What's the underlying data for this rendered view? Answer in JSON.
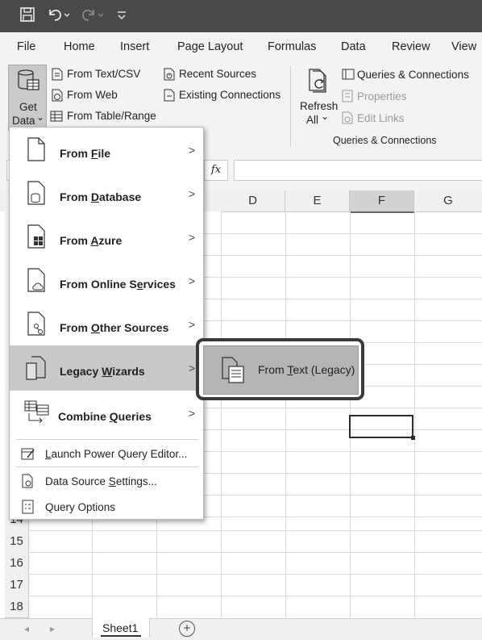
{
  "title_bar": {
    "icons": [
      "save-icon",
      "undo-icon",
      "redo-icon",
      "customize-qat-icon"
    ]
  },
  "menu_tabs": [
    {
      "label": "File"
    },
    {
      "label": "Home"
    },
    {
      "label": "Insert"
    },
    {
      "label": "Page Layout"
    },
    {
      "label": "Formulas"
    },
    {
      "label": "Data",
      "active": true
    },
    {
      "label": "Review"
    },
    {
      "label": "View"
    }
  ],
  "ribbon": {
    "get_data": {
      "line1": "Get",
      "line2": "Data",
      "chevron": "⌄"
    },
    "get_transform": [
      "From Text/CSV",
      "From Web",
      "From Table/Range"
    ],
    "recent": [
      "Recent Sources",
      "Existing Connections"
    ],
    "refresh": {
      "line1": "Refresh",
      "line2": "All",
      "chevron": "⌄"
    },
    "queries": {
      "queries_connections": "Queries & Connections",
      "properties": "Properties",
      "edit_links": "Edit Links",
      "group_label": "Queries & Connections"
    }
  },
  "formula_bar": {
    "fx": "fx"
  },
  "columns": [
    "D",
    "E",
    "F",
    "G"
  ],
  "selected_column": "F",
  "rows": [
    "14",
    "15",
    "16",
    "17",
    "18"
  ],
  "dropdown": {
    "items": [
      {
        "pre": "From ",
        "u": "F",
        "post": "ile",
        "submenu": true
      },
      {
        "pre": "From ",
        "u": "D",
        "post": "atabase",
        "submenu": true
      },
      {
        "pre": "From ",
        "u": "A",
        "post": "zure",
        "submenu": true
      },
      {
        "pre": "From Online S",
        "u": "e",
        "post": "rvices",
        "submenu": true
      },
      {
        "pre": "From ",
        "u": "O",
        "post": "ther Sources",
        "submenu": true
      },
      {
        "pre": "Legacy ",
        "u": "W",
        "post": "izards",
        "submenu": true,
        "highlighted": true
      },
      {
        "pre": "Combine ",
        "u": "Q",
        "post": "ueries",
        "submenu": true
      }
    ],
    "commands": [
      {
        "pre": "",
        "u": "L",
        "post": "aunch Power Query Editor..."
      },
      {
        "pre": "Data Source ",
        "u": "S",
        "post": "ettings..."
      },
      {
        "pre": "Query Options",
        "u": "",
        "post": ""
      }
    ],
    "chevron": ">"
  },
  "submenu": {
    "pre": "From ",
    "u": "T",
    "post": "ext (Legacy)"
  },
  "sheet_tabs": {
    "active": "Sheet1",
    "add": "+",
    "nav_left": "◂",
    "nav_right": "▸"
  }
}
